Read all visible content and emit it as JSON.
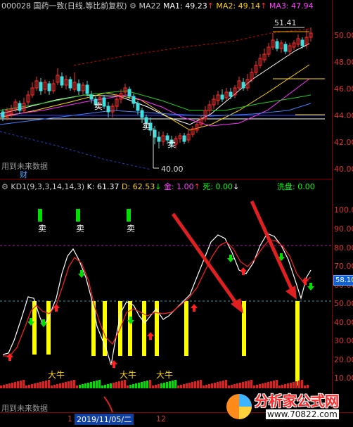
{
  "kline_header": {
    "code": "000028",
    "name_period": "国药一致(日线,等比前复权)",
    "ma_label": "MA22",
    "ma1": "MA1: 49.23",
    "ma2": "MA2: 49.14",
    "ma3": "MA3: 47.94"
  },
  "kline": {
    "y_ticks": [
      "50.00",
      "48.00",
      "46.00",
      "44.00",
      "42.00",
      "40.00"
    ],
    "high_label": "51.41",
    "low_label": "40.00",
    "future_note": "用到未来数据",
    "cai_label": "财",
    "sell_label": "卖",
    "arrow_up": "↑",
    "arrow_down": "↓"
  },
  "kd_header": {
    "title": "KD1(9,3,3,14,14,3)",
    "k": "K: 61.37",
    "d": "D: 62.53",
    "jin": "金: 1.00",
    "si": "死: 0.00",
    "xipan": "洗盘: 0.00"
  },
  "kd": {
    "y_ticks": [
      "100.00",
      "90.00",
      "80.00",
      "70.00",
      "60.00",
      "50.00",
      "40.00",
      "30.00",
      "20.00",
      "10.00"
    ],
    "current_tag": "58.10",
    "sell_labels": [
      "卖",
      "卖",
      "卖"
    ],
    "daniu_labels": [
      "大牛",
      "大牛",
      "大牛"
    ],
    "future_note": "用到未来数据"
  },
  "bottom_bar": {
    "left_num": "1",
    "date": "2019/11/05/二",
    "right_num": "12"
  },
  "watermark": {
    "text": "分析家公式网",
    "url": "www.70822.com"
  },
  "colors": {
    "up": "#ff3030",
    "down": "#40e0e0",
    "yellow": "#ffff00",
    "green": "#00e000",
    "magenta": "#ff00ff"
  }
}
